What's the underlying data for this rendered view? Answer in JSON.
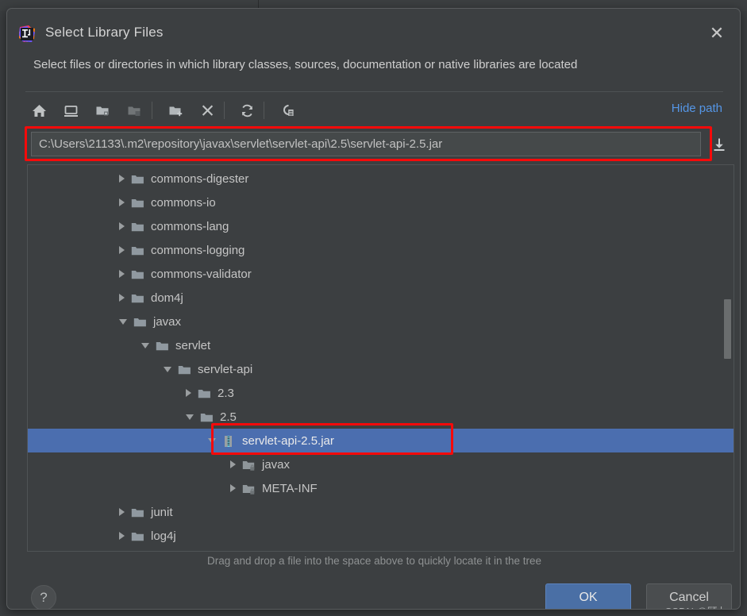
{
  "window": {
    "title": "Select Library Files",
    "icon": "intellij-idea-logo",
    "close_label": "✕",
    "subtitle": "Select files or directories in which library classes, sources, documentation or native libraries are located"
  },
  "toolbar": {
    "buttons": [
      {
        "name": "home-icon",
        "tooltip": "Home"
      },
      {
        "name": "desktop-icon",
        "tooltip": "Desktop"
      },
      {
        "name": "project-folder-icon",
        "tooltip": "Project"
      },
      {
        "name": "module-folder-icon",
        "tooltip": "Module"
      },
      {
        "name": "new-folder-icon",
        "tooltip": "New Folder"
      },
      {
        "name": "delete-icon",
        "tooltip": "Delete"
      },
      {
        "name": "refresh-icon",
        "tooltip": "Refresh"
      },
      {
        "name": "show-hidden-icon",
        "tooltip": "Show Hidden Files and Directories"
      }
    ],
    "hide_path_label": "Hide path"
  },
  "path": {
    "value": "C:\\Users\\21133\\.m2\\repository\\javax\\servlet\\servlet-api\\2.5\\servlet-api-2.5.jar",
    "placeholder": "",
    "dropdown_icon": "download-arrow-icon"
  },
  "tree": {
    "rows": [
      {
        "label": "commons-digester",
        "indent": 0,
        "arrow": "collapsed",
        "icon": "folder-icon",
        "selected": false
      },
      {
        "label": "commons-io",
        "indent": 0,
        "arrow": "collapsed",
        "icon": "folder-icon",
        "selected": false
      },
      {
        "label": "commons-lang",
        "indent": 0,
        "arrow": "collapsed",
        "icon": "folder-icon",
        "selected": false
      },
      {
        "label": "commons-logging",
        "indent": 0,
        "arrow": "collapsed",
        "icon": "folder-icon",
        "selected": false
      },
      {
        "label": "commons-validator",
        "indent": 0,
        "arrow": "collapsed",
        "icon": "folder-icon",
        "selected": false
      },
      {
        "label": "dom4j",
        "indent": 0,
        "arrow": "collapsed",
        "icon": "folder-icon",
        "selected": false
      },
      {
        "label": "javax",
        "indent": 0,
        "arrow": "expanded",
        "icon": "folder-icon",
        "selected": false
      },
      {
        "label": "servlet",
        "indent": 1,
        "arrow": "expanded",
        "icon": "folder-icon",
        "selected": false
      },
      {
        "label": "servlet-api",
        "indent": 2,
        "arrow": "expanded",
        "icon": "folder-icon",
        "selected": false
      },
      {
        "label": "2.3",
        "indent": 3,
        "arrow": "collapsed",
        "icon": "folder-icon",
        "selected": false
      },
      {
        "label": "2.5",
        "indent": 3,
        "arrow": "expanded",
        "icon": "folder-icon",
        "selected": false
      },
      {
        "label": "servlet-api-2.5.jar",
        "indent": 4,
        "arrow": "expanded",
        "icon": "jar-icon",
        "selected": true
      },
      {
        "label": "javax",
        "indent": 5,
        "arrow": "collapsed",
        "icon": "jar-folder-icon",
        "selected": false
      },
      {
        "label": "META-INF",
        "indent": 5,
        "arrow": "collapsed",
        "icon": "jar-folder-icon",
        "selected": false
      },
      {
        "label": "junit",
        "indent": 0,
        "arrow": "collapsed",
        "icon": "folder-icon",
        "selected": false
      },
      {
        "label": "log4j",
        "indent": 0,
        "arrow": "collapsed",
        "icon": "folder-icon",
        "selected": false
      }
    ]
  },
  "hint": {
    "text": "Drag and drop a file into the space above to quickly locate it in the tree"
  },
  "footer": {
    "help_label": "?",
    "ok_label": "OK",
    "cancel_label": "Cancel"
  },
  "watermark": {
    "text": "CSDN @顾七a"
  },
  "colors": {
    "dialog_bg": "#3c3f41",
    "selection": "#4b6eaf",
    "accent_link": "#5596e6",
    "annotation_red": "#f60a0a",
    "ok_button": "#4a6fa5"
  }
}
